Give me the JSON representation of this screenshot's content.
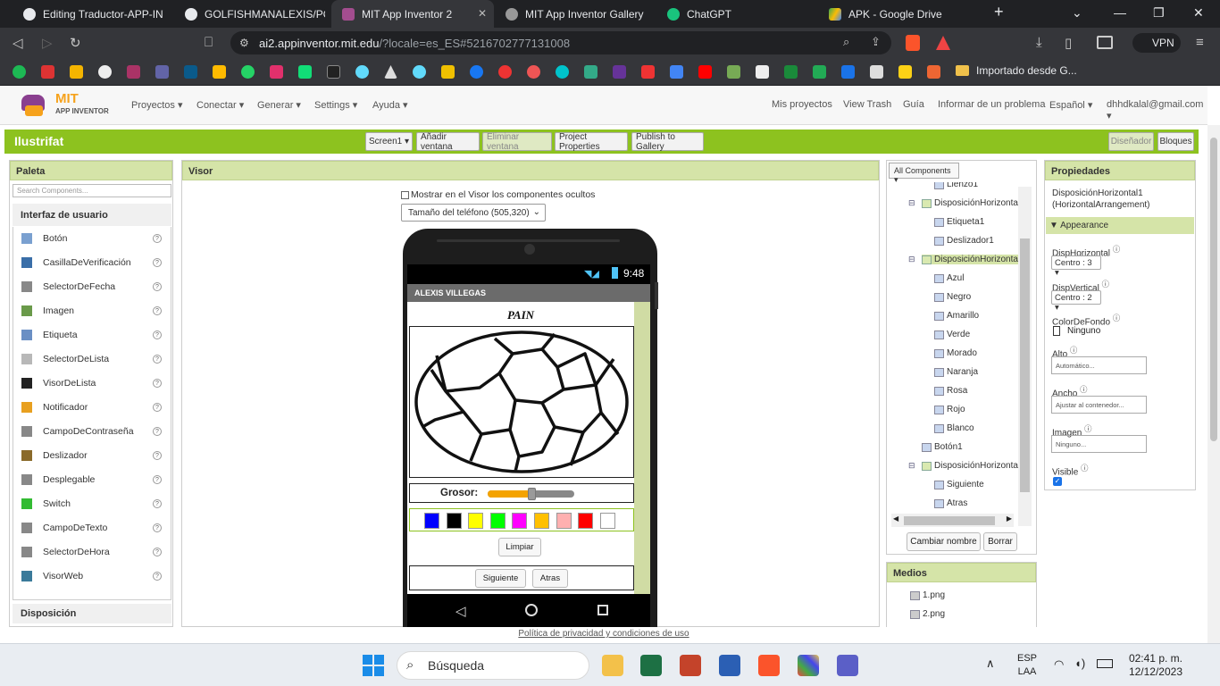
{
  "browser": {
    "tabs": [
      {
        "title": "Editing Traductor-APP-INVE",
        "color": "#e8eaed",
        "active": false
      },
      {
        "title": "GOLFISHMANALEXIS/PODC",
        "color": "#e8eaed",
        "active": false
      },
      {
        "title": "MIT App Inventor 2",
        "color": "#e8eaed",
        "active": true
      },
      {
        "title": "MIT App Inventor Gallery",
        "color": "#e8eaed",
        "active": false
      },
      {
        "title": "ChatGPT",
        "color": "#e8eaed",
        "active": false
      },
      {
        "title": "APK - Google Drive",
        "color": "#e8eaed",
        "active": false
      }
    ],
    "new_tab": "+",
    "url_host": "ai2.appinventor.mit.edu",
    "url_path": "/?locale=es_ES#5216702777131008",
    "vpn_label": "VPN",
    "bookmark_folder": "Importado desde G..."
  },
  "ai": {
    "logo_line1": "MIT",
    "logo_line2": "APP INVENTOR",
    "menus": [
      "Proyectos",
      "Conectar",
      "Generar",
      "Settings",
      "Ayuda"
    ],
    "right_menus": [
      "Mis proyectos",
      "View Trash",
      "Guía",
      "Informar de un problema",
      "Español",
      "dhhdkalal@gmail.com"
    ],
    "project_name": "Ilustrifat",
    "toolbar": {
      "screen": "Screen1",
      "add_screen": "Añadir ventana",
      "remove_screen": "Eliminar ventana",
      "project_props": "Project Properties",
      "publish": "Publish to Gallery",
      "designer": "Diseñador",
      "blocks": "Bloques"
    }
  },
  "palette": {
    "title": "Paleta",
    "search_placeholder": "Search Components...",
    "category": "Interfaz de usuario",
    "items": [
      "Botón",
      "CasillaDeVerificación",
      "SelectorDeFecha",
      "Imagen",
      "Etiqueta",
      "SelectorDeLista",
      "VisorDeLista",
      "Notificador",
      "CampoDeContraseña",
      "Deslizador",
      "Desplegable",
      "Switch",
      "CampoDeTexto",
      "SelectorDeHora",
      "VisorWeb"
    ],
    "category2": "Disposición",
    "help": "?"
  },
  "viewer": {
    "title": "Visor",
    "show_hidden": "Mostrar en el Visor los componentes ocultos",
    "phone_size": "Tamaño del teléfono (505,320)",
    "status_time": "9:48",
    "app_title": "ALEXIS VILLEGAS",
    "paint_label": "PAIN",
    "grosor_label": "Grosor:",
    "slider_value": 0.5,
    "colors": [
      "#0000ff",
      "#000000",
      "#ffff00",
      "#00ff00",
      "#ff00ff",
      "#ffc000",
      "#ffb0b0",
      "#ff0000",
      "#ffffff"
    ],
    "clear_button": "Limpiar",
    "next_button": "Siguiente",
    "back_button": "Atras"
  },
  "components": {
    "filter": "All Components",
    "nodes": [
      {
        "label": "Lienzo1",
        "level": 2,
        "icon": "canvas",
        "toggle": ""
      },
      {
        "label": "DisposiciónHorizonta",
        "level": 1,
        "icon": "horizontal",
        "toggle": "⊟"
      },
      {
        "label": "Etiqueta1",
        "level": 2,
        "icon": "label",
        "toggle": ""
      },
      {
        "label": "Deslizador1",
        "level": 2,
        "icon": "slider",
        "toggle": ""
      },
      {
        "label": "DisposiciónHorizonta",
        "level": 1,
        "icon": "horizontal",
        "toggle": "⊟",
        "selected": true
      },
      {
        "label": "Azul",
        "level": 2,
        "icon": "button",
        "toggle": ""
      },
      {
        "label": "Negro",
        "level": 2,
        "icon": "button",
        "toggle": ""
      },
      {
        "label": "Amarillo",
        "level": 2,
        "icon": "button",
        "toggle": ""
      },
      {
        "label": "Verde",
        "level": 2,
        "icon": "button",
        "toggle": ""
      },
      {
        "label": "Morado",
        "level": 2,
        "icon": "button",
        "toggle": ""
      },
      {
        "label": "Naranja",
        "level": 2,
        "icon": "button",
        "toggle": ""
      },
      {
        "label": "Rosa",
        "level": 2,
        "icon": "button",
        "toggle": ""
      },
      {
        "label": "Rojo",
        "level": 2,
        "icon": "button",
        "toggle": ""
      },
      {
        "label": "Blanco",
        "level": 2,
        "icon": "button",
        "toggle": ""
      },
      {
        "label": "Botón1",
        "level": 1,
        "icon": "button",
        "toggle": ""
      },
      {
        "label": "DisposiciónHorizonta",
        "level": 1,
        "icon": "horizontal",
        "toggle": "⊟"
      },
      {
        "label": "Siguiente",
        "level": 2,
        "icon": "button",
        "toggle": ""
      },
      {
        "label": "Atras",
        "level": 2,
        "icon": "button",
        "toggle": ""
      }
    ],
    "rename": "Cambiar nombre",
    "delete": "Borrar"
  },
  "media": {
    "title": "Medios",
    "files": [
      "1.png",
      "2.png"
    ]
  },
  "properties": {
    "title": "Propiedades",
    "component": "DisposiciónHorizontal1",
    "component_type": "(HorizontalArrangement)",
    "section": "Appearance",
    "align_h_label": "DispHorizontal",
    "align_h_value": "Centro : 3",
    "align_v_label": "DispVertical",
    "align_v_value": "Centro : 2",
    "bg_label": "ColorDeFondo",
    "bg_value": "Ninguno",
    "height_label": "Alto",
    "height_value": "Automático...",
    "width_label": "Ancho",
    "width_value": "Ajustar al contenedor...",
    "image_label": "Imagen",
    "image_value": "Ninguno...",
    "visible_label": "Visible",
    "visible": true
  },
  "footer": "Política de privacidad y condiciones de uso",
  "taskbar": {
    "search": "Búsqueda",
    "lang1": "ESP",
    "lang2": "LAA",
    "time": "02:41 p. m.",
    "date": "12/12/2023"
  }
}
